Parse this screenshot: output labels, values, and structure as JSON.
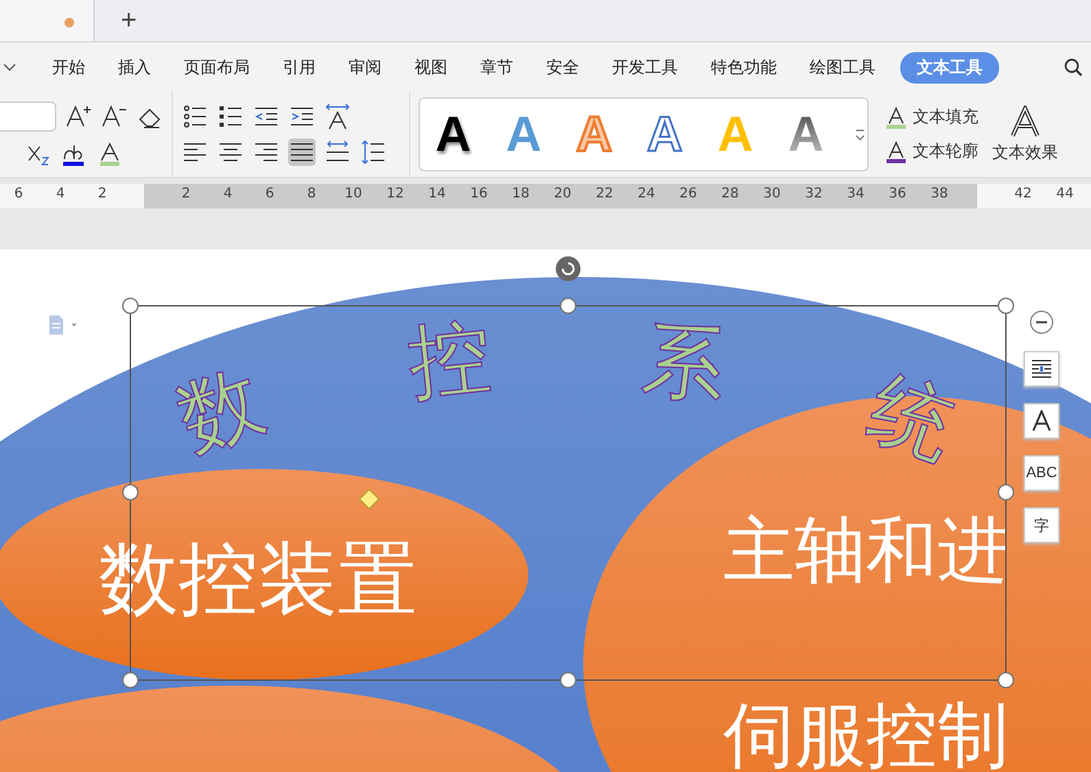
{
  "document_tab": {
    "modified": true
  },
  "new_tab_button": "+",
  "menu": [
    {
      "label": "开始",
      "selected": false
    },
    {
      "label": "插入",
      "selected": false
    },
    {
      "label": "页面布局",
      "selected": false
    },
    {
      "label": "引用",
      "selected": false
    },
    {
      "label": "审阅",
      "selected": false
    },
    {
      "label": "视图",
      "selected": false
    },
    {
      "label": "章节",
      "selected": false
    },
    {
      "label": "安全",
      "selected": false
    },
    {
      "label": "开发工具",
      "selected": false
    },
    {
      "label": "特色功能",
      "selected": false
    },
    {
      "label": "绘图工具",
      "selected": false
    },
    {
      "label": "文本工具",
      "selected": true
    }
  ],
  "alignment": [
    {
      "selected": false
    },
    {
      "selected": false
    },
    {
      "selected": false
    },
    {
      "selected": true
    },
    {
      "selected": false
    }
  ],
  "wordart_styles": [
    {
      "glyph": "A",
      "kind": "solid-dark"
    },
    {
      "glyph": "A",
      "kind": "solid-blue"
    },
    {
      "glyph": "A",
      "kind": "outline-orange"
    },
    {
      "glyph": "A",
      "kind": "outline-blue"
    },
    {
      "glyph": "A",
      "kind": "solid-gold"
    },
    {
      "glyph": "A",
      "kind": "gradient-gray"
    }
  ],
  "text_commands": [
    {
      "label": "文本填充",
      "kind": "fill"
    },
    {
      "label": "文本轮廓",
      "kind": "outline"
    }
  ],
  "text_effects": "文本效果",
  "ruler": {
    "labels": [
      "6",
      "4",
      "2",
      "2",
      "4",
      "6",
      "8",
      "10",
      "12",
      "14",
      "16",
      "18",
      "20",
      "22",
      "24",
      "26",
      "28",
      "30",
      "32",
      "34",
      "36",
      "38",
      "42",
      "44"
    ]
  },
  "canvas": {
    "wordart": "数控系统",
    "shapes": [
      {
        "kind": "left",
        "lines": [
          "数控装置"
        ]
      },
      {
        "kind": "bottom"
      },
      {
        "kind": "right",
        "lines": [
          "主轴和进",
          "伺服控制"
        ]
      }
    ],
    "float_tools": [
      {
        "kind": "wrap"
      },
      {
        "kind": "outline"
      },
      {
        "kind": "text",
        "glyph": "ABC"
      },
      {
        "kind": "text",
        "glyph": "字"
      }
    ]
  }
}
